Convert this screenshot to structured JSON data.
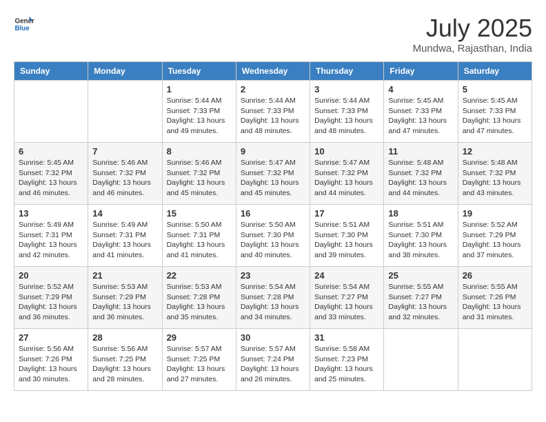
{
  "header": {
    "logo_general": "General",
    "logo_blue": "Blue",
    "month_title": "July 2025",
    "location": "Mundwa, Rajasthan, India"
  },
  "weekdays": [
    "Sunday",
    "Monday",
    "Tuesday",
    "Wednesday",
    "Thursday",
    "Friday",
    "Saturday"
  ],
  "weeks": [
    [
      {
        "day": "",
        "info": ""
      },
      {
        "day": "",
        "info": ""
      },
      {
        "day": "1",
        "info": "Sunrise: 5:44 AM\nSunset: 7:33 PM\nDaylight: 13 hours and 49 minutes."
      },
      {
        "day": "2",
        "info": "Sunrise: 5:44 AM\nSunset: 7:33 PM\nDaylight: 13 hours and 48 minutes."
      },
      {
        "day": "3",
        "info": "Sunrise: 5:44 AM\nSunset: 7:33 PM\nDaylight: 13 hours and 48 minutes."
      },
      {
        "day": "4",
        "info": "Sunrise: 5:45 AM\nSunset: 7:33 PM\nDaylight: 13 hours and 47 minutes."
      },
      {
        "day": "5",
        "info": "Sunrise: 5:45 AM\nSunset: 7:33 PM\nDaylight: 13 hours and 47 minutes."
      }
    ],
    [
      {
        "day": "6",
        "info": "Sunrise: 5:45 AM\nSunset: 7:32 PM\nDaylight: 13 hours and 46 minutes."
      },
      {
        "day": "7",
        "info": "Sunrise: 5:46 AM\nSunset: 7:32 PM\nDaylight: 13 hours and 46 minutes."
      },
      {
        "day": "8",
        "info": "Sunrise: 5:46 AM\nSunset: 7:32 PM\nDaylight: 13 hours and 45 minutes."
      },
      {
        "day": "9",
        "info": "Sunrise: 5:47 AM\nSunset: 7:32 PM\nDaylight: 13 hours and 45 minutes."
      },
      {
        "day": "10",
        "info": "Sunrise: 5:47 AM\nSunset: 7:32 PM\nDaylight: 13 hours and 44 minutes."
      },
      {
        "day": "11",
        "info": "Sunrise: 5:48 AM\nSunset: 7:32 PM\nDaylight: 13 hours and 44 minutes."
      },
      {
        "day": "12",
        "info": "Sunrise: 5:48 AM\nSunset: 7:32 PM\nDaylight: 13 hours and 43 minutes."
      }
    ],
    [
      {
        "day": "13",
        "info": "Sunrise: 5:49 AM\nSunset: 7:31 PM\nDaylight: 13 hours and 42 minutes."
      },
      {
        "day": "14",
        "info": "Sunrise: 5:49 AM\nSunset: 7:31 PM\nDaylight: 13 hours and 41 minutes."
      },
      {
        "day": "15",
        "info": "Sunrise: 5:50 AM\nSunset: 7:31 PM\nDaylight: 13 hours and 41 minutes."
      },
      {
        "day": "16",
        "info": "Sunrise: 5:50 AM\nSunset: 7:30 PM\nDaylight: 13 hours and 40 minutes."
      },
      {
        "day": "17",
        "info": "Sunrise: 5:51 AM\nSunset: 7:30 PM\nDaylight: 13 hours and 39 minutes."
      },
      {
        "day": "18",
        "info": "Sunrise: 5:51 AM\nSunset: 7:30 PM\nDaylight: 13 hours and 38 minutes."
      },
      {
        "day": "19",
        "info": "Sunrise: 5:52 AM\nSunset: 7:29 PM\nDaylight: 13 hours and 37 minutes."
      }
    ],
    [
      {
        "day": "20",
        "info": "Sunrise: 5:52 AM\nSunset: 7:29 PM\nDaylight: 13 hours and 36 minutes."
      },
      {
        "day": "21",
        "info": "Sunrise: 5:53 AM\nSunset: 7:29 PM\nDaylight: 13 hours and 36 minutes."
      },
      {
        "day": "22",
        "info": "Sunrise: 5:53 AM\nSunset: 7:28 PM\nDaylight: 13 hours and 35 minutes."
      },
      {
        "day": "23",
        "info": "Sunrise: 5:54 AM\nSunset: 7:28 PM\nDaylight: 13 hours and 34 minutes."
      },
      {
        "day": "24",
        "info": "Sunrise: 5:54 AM\nSunset: 7:27 PM\nDaylight: 13 hours and 33 minutes."
      },
      {
        "day": "25",
        "info": "Sunrise: 5:55 AM\nSunset: 7:27 PM\nDaylight: 13 hours and 32 minutes."
      },
      {
        "day": "26",
        "info": "Sunrise: 5:55 AM\nSunset: 7:26 PM\nDaylight: 13 hours and 31 minutes."
      }
    ],
    [
      {
        "day": "27",
        "info": "Sunrise: 5:56 AM\nSunset: 7:26 PM\nDaylight: 13 hours and 30 minutes."
      },
      {
        "day": "28",
        "info": "Sunrise: 5:56 AM\nSunset: 7:25 PM\nDaylight: 13 hours and 28 minutes."
      },
      {
        "day": "29",
        "info": "Sunrise: 5:57 AM\nSunset: 7:25 PM\nDaylight: 13 hours and 27 minutes."
      },
      {
        "day": "30",
        "info": "Sunrise: 5:57 AM\nSunset: 7:24 PM\nDaylight: 13 hours and 26 minutes."
      },
      {
        "day": "31",
        "info": "Sunrise: 5:58 AM\nSunset: 7:23 PM\nDaylight: 13 hours and 25 minutes."
      },
      {
        "day": "",
        "info": ""
      },
      {
        "day": "",
        "info": ""
      }
    ]
  ]
}
